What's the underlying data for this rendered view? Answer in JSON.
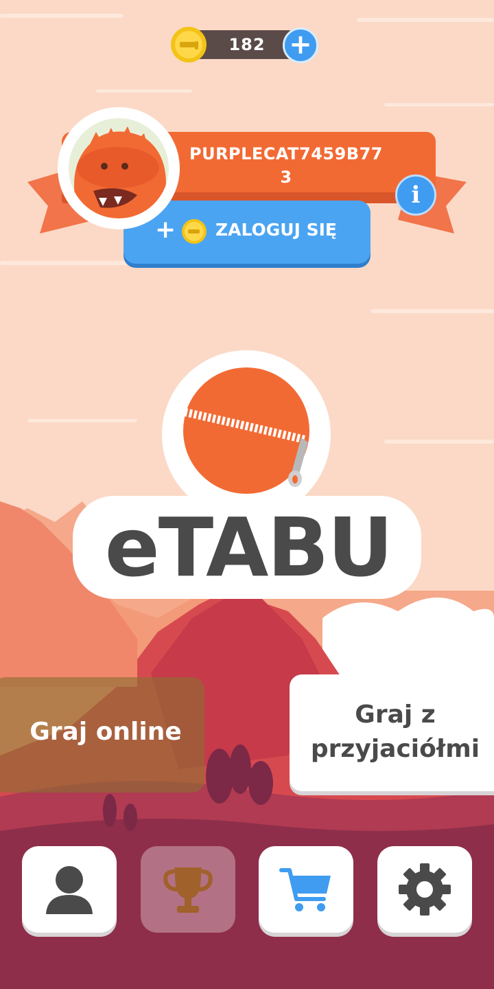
{
  "header": {
    "coins": "182",
    "coin_plus_label": "+"
  },
  "profile": {
    "username": "PURPLECAT7459B77\n3",
    "info_label": "i",
    "login_plus": "+",
    "login_label": "ZALOGUJ SIĘ"
  },
  "logo": {
    "text": "eTABU"
  },
  "play": {
    "online_label": "Graj online",
    "friends_label": "Graj z przyjaciółmi"
  },
  "nav": [
    {
      "icon": "profile-icon"
    },
    {
      "icon": "trophy-icon"
    },
    {
      "icon": "cart-icon"
    },
    {
      "icon": "gear-icon"
    }
  ],
  "colors": {
    "background": "#fbd9c6",
    "accent_orange": "#f26a33",
    "accent_blue": "#3f9cf0",
    "text_dark": "#4a4a4a"
  }
}
